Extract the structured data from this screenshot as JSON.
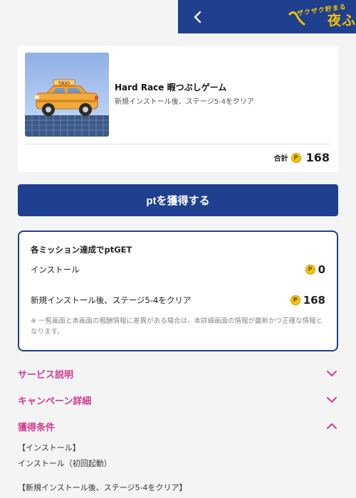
{
  "header": {
    "logo_small": "ザクザク貯まる",
    "logo_big": "夜ふ"
  },
  "app": {
    "title": "Hard Race 暇つぶしゲーム",
    "description": "新規インストール後、ステージ5-4をクリア",
    "thumb_sign": "TAXI",
    "total_label": "合計",
    "total_value": "168"
  },
  "coin_symbol": "P",
  "cta_label": "ptを獲得する",
  "missions": {
    "heading": "各ミッション達成でptGET",
    "items": [
      {
        "label": "インストール",
        "points": "0"
      },
      {
        "label": "新規インストール後、ステージ5-4をクリア",
        "points": "168"
      }
    ],
    "note": "※ 一覧画面と本画面の報酬情報に差異がある場合は、本詳細画面の情報が最新かつ正確な情報となります。"
  },
  "sections": {
    "service": "サービス説明",
    "campaign": "キャンペーン詳細",
    "conditions": "獲得条件"
  },
  "conditions": {
    "line1": "【インストール】",
    "line2": "インストール（初回起動）",
    "line3": "【新規インストール後、ステージ5-4をクリア】"
  },
  "colors": {
    "navy": "#1f3f8f",
    "accent_pink": "#d23b8f",
    "coin_yellow": "#f4c700"
  }
}
